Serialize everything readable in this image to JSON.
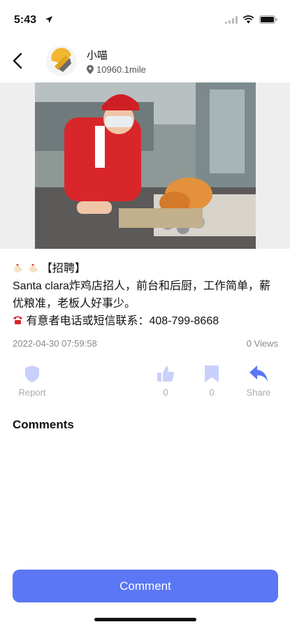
{
  "status_bar": {
    "time": "5:43"
  },
  "header": {
    "author_name": "小喵",
    "distance": "10960.1mile"
  },
  "post": {
    "tag_line": "【招聘】",
    "line1": "Santa clara炸鸡店招人，前台和后厨，工作简单，薪优粮准，老板人好事少。",
    "contact_label": "有意者电话或短信联系：",
    "contact_phone": "408-799-8668",
    "timestamp": "2022-04-30 07:59:58",
    "views": "0 Views"
  },
  "actions": {
    "report_label": "Report",
    "like_count": "0",
    "bookmark_count": "0",
    "share_label": "Share"
  },
  "comments": {
    "title": "Comments"
  },
  "comment_button": {
    "label": "Comment"
  },
  "colors": {
    "accent": "#5b77f5",
    "icon_muted": "#c8d0fb"
  },
  "icons": [
    "back-arrow-icon",
    "location-pin-icon",
    "shield-icon",
    "thumbs-up-icon",
    "bookmark-icon",
    "share-icon",
    "wifi-icon",
    "battery-icon",
    "signal-icon"
  ]
}
